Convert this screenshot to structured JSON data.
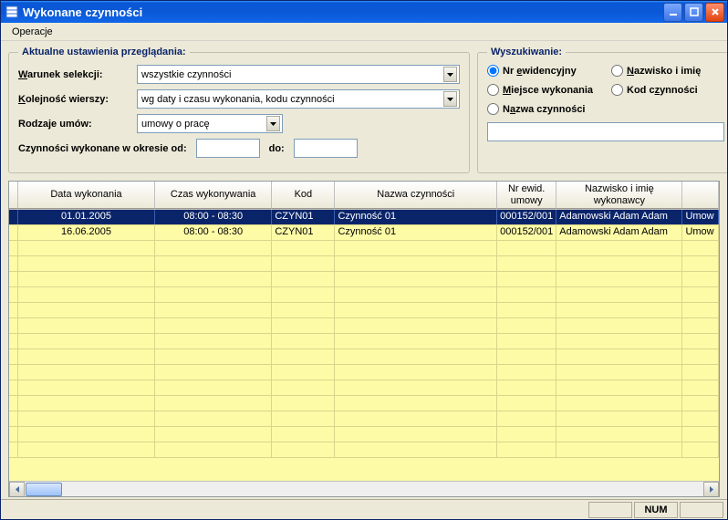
{
  "window": {
    "title": "Wykonane czynności"
  },
  "menubar": {
    "operacje": "Operacje"
  },
  "settings": {
    "legend": "Aktualne ustawienia przeglądania:",
    "warunek_label_pre": "W",
    "warunek_label_post": "arunek selekcji:",
    "warunek_value": "wszystkie czynności",
    "kolejnosc_label_pre": "K",
    "kolejnosc_label_post": "olejność wierszy:",
    "kolejnosc_value": "wg daty i czasu wykonania, kodu czynności",
    "rodzaje_label": "Rodzaje umów:",
    "rodzaje_value": "umowy o pracę",
    "okres_label": "Czynności wykonane w okresie od:",
    "okres_do": "do:"
  },
  "search": {
    "legend": "Wyszukiwanie:",
    "nr_ewid_pre": "Nr ",
    "nr_ewid_ul": "e",
    "nr_ewid_post": "widencyjny",
    "nazwisko_pre": "",
    "nazwisko_ul": "N",
    "nazwisko_post": "azwisko i imię",
    "miejsce_pre": "",
    "miejsce_ul": "M",
    "miejsce_post": "iejsce wykonania",
    "kod_pre": "Kod c",
    "kod_ul": "z",
    "kod_post": "ynności",
    "nazwa_pre": "N",
    "nazwa_ul": "a",
    "nazwa_post": "zwa czynności"
  },
  "grid": {
    "headers": {
      "blank": "",
      "data": "Data wykonania",
      "czas": "Czas wykonywania",
      "kod": "Kod",
      "nazwa": "Nazwa czynności",
      "nrewid": "Nr ewid. umowy",
      "nazwisko": "Nazwisko i imię wykonawcy",
      "umowa": ""
    },
    "rows": [
      {
        "data": "01.01.2005",
        "czas": "08:00 - 08:30",
        "kod": "CZYN01",
        "nazwa": "Czynność 01",
        "nrewid": "000152/001",
        "nazwisko": "Adamowski Adam Adam",
        "umowa": "Umow"
      },
      {
        "data": "16.06.2005",
        "czas": "08:00 - 08:30",
        "kod": "CZYN01",
        "nazwa": "Czynność 01",
        "nrewid": "000152/001",
        "nazwisko": "Adamowski Adam Adam",
        "umowa": "Umow"
      }
    ]
  },
  "statusbar": {
    "num": "NUM"
  }
}
